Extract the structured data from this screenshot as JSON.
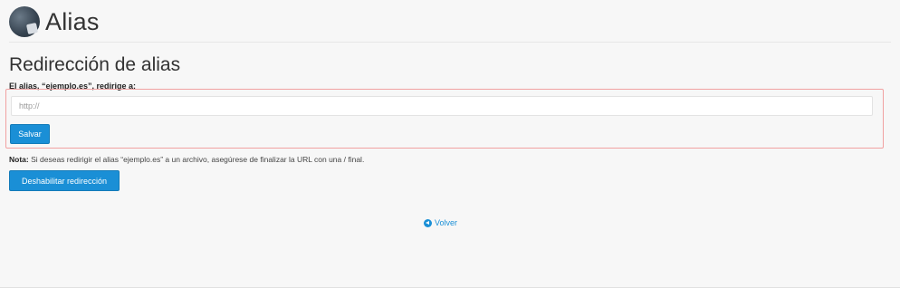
{
  "header": {
    "title": "Alias",
    "icon": "alias-icon"
  },
  "section": {
    "title": "Redirección de alias",
    "label": "El alias, “ejemplo.es”, redirige a:"
  },
  "form": {
    "url_placeholder": "http://",
    "save_label": "Salvar"
  },
  "note": {
    "prefix": "Nota:",
    "text": " Si deseas redirigir el alias “ejemplo.es” a un archivo, asegúrese de finalizar la URL con una / final."
  },
  "disable_button": "Deshabilitar redirección",
  "back": {
    "icon": "back-arrow-icon",
    "label": "Volver"
  },
  "colors": {
    "accent": "#1a8fd6",
    "highlight_border": "#f1a1a1",
    "background": "#f7f7f7"
  }
}
